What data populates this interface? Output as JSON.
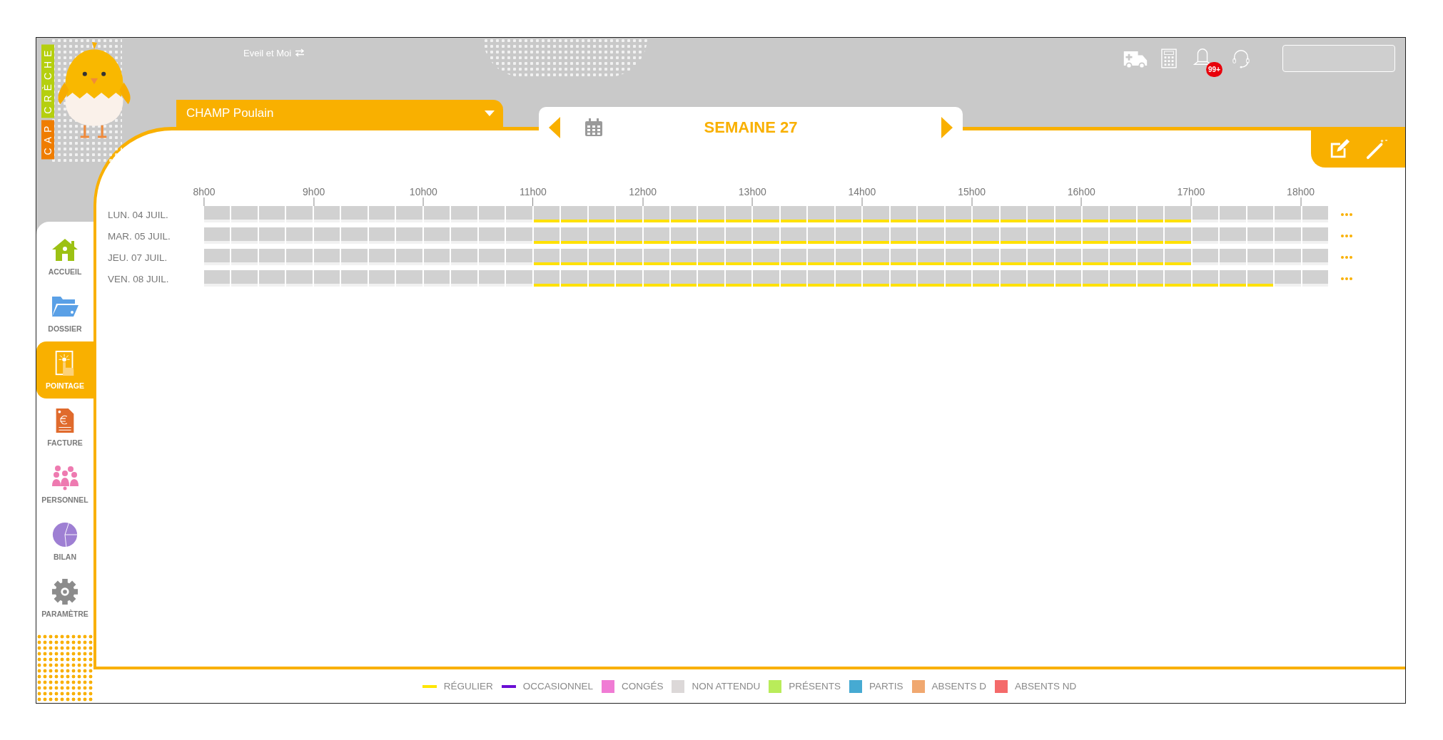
{
  "header": {
    "logo": {
      "first": "CAP",
      "second": "CRÈCHE"
    },
    "structure": "Eveil et Moi",
    "notification_count": "99+"
  },
  "child_selector": {
    "value": "CHAMP Poulain"
  },
  "week": {
    "label": "SEMAINE 27"
  },
  "sidebar": {
    "items": [
      {
        "kind": "home",
        "label": "ACCUEIL",
        "selected": false
      },
      {
        "kind": "folder",
        "label": "DOSSIER",
        "selected": false
      },
      {
        "kind": "pointage",
        "label": "POINTAGE",
        "selected": true
      },
      {
        "kind": "invoice",
        "label": "FACTURE",
        "selected": false
      },
      {
        "kind": "people",
        "label": "PERSONNEL",
        "selected": false
      },
      {
        "kind": "pie",
        "label": "BILAN",
        "selected": false
      },
      {
        "kind": "gear",
        "label": "PARAMÈTRE",
        "selected": false
      }
    ]
  },
  "timeline": {
    "hours": [
      "8h00",
      "9h00",
      "10h00",
      "11h00",
      "12h00",
      "13h00",
      "14h00",
      "15h00",
      "16h00",
      "17h00",
      "18h00"
    ],
    "days": [
      {
        "label": "LUN. 04 JUIL.",
        "slots": [
          {
            "regular": false
          },
          {
            "regular": false
          },
          {
            "regular": false
          },
          {
            "regular": false
          },
          {
            "regular": false
          },
          {
            "regular": false
          },
          {
            "regular": false
          },
          {
            "regular": false
          },
          {
            "regular": false
          },
          {
            "regular": false
          },
          {
            "regular": false
          },
          {
            "regular": false
          },
          {
            "regular": true
          },
          {
            "regular": true
          },
          {
            "regular": true
          },
          {
            "regular": true
          },
          {
            "regular": true
          },
          {
            "regular": true
          },
          {
            "regular": true
          },
          {
            "regular": true
          },
          {
            "regular": true
          },
          {
            "regular": true
          },
          {
            "regular": true
          },
          {
            "regular": true
          },
          {
            "regular": true
          },
          {
            "regular": true
          },
          {
            "regular": true
          },
          {
            "regular": true
          },
          {
            "regular": true
          },
          {
            "regular": true
          },
          {
            "regular": true
          },
          {
            "regular": true
          },
          {
            "regular": true
          },
          {
            "regular": true
          },
          {
            "regular": true
          },
          {
            "regular": true
          },
          {
            "regular": false
          },
          {
            "regular": false
          },
          {
            "regular": false
          },
          {
            "regular": false
          },
          {
            "regular": false
          }
        ]
      },
      {
        "label": "MAR. 05 JUIL.",
        "slots": [
          {
            "regular": false
          },
          {
            "regular": false
          },
          {
            "regular": false
          },
          {
            "regular": false
          },
          {
            "regular": false
          },
          {
            "regular": false
          },
          {
            "regular": false
          },
          {
            "regular": false
          },
          {
            "regular": false
          },
          {
            "regular": false
          },
          {
            "regular": false
          },
          {
            "regular": false
          },
          {
            "regular": true
          },
          {
            "regular": true
          },
          {
            "regular": true
          },
          {
            "regular": true
          },
          {
            "regular": true
          },
          {
            "regular": true
          },
          {
            "regular": true
          },
          {
            "regular": true
          },
          {
            "regular": true
          },
          {
            "regular": true
          },
          {
            "regular": true
          },
          {
            "regular": true
          },
          {
            "regular": true
          },
          {
            "regular": true
          },
          {
            "regular": true
          },
          {
            "regular": true
          },
          {
            "regular": true
          },
          {
            "regular": true
          },
          {
            "regular": true
          },
          {
            "regular": true
          },
          {
            "regular": true
          },
          {
            "regular": true
          },
          {
            "regular": true
          },
          {
            "regular": true
          },
          {
            "regular": false
          },
          {
            "regular": false
          },
          {
            "regular": false
          },
          {
            "regular": false
          },
          {
            "regular": false
          }
        ]
      },
      {
        "label": "JEU. 07 JUIL.",
        "slots": [
          {
            "regular": false
          },
          {
            "regular": false
          },
          {
            "regular": false
          },
          {
            "regular": false
          },
          {
            "regular": false
          },
          {
            "regular": false
          },
          {
            "regular": false
          },
          {
            "regular": false
          },
          {
            "regular": false
          },
          {
            "regular": false
          },
          {
            "regular": false
          },
          {
            "regular": false
          },
          {
            "regular": true
          },
          {
            "regular": true
          },
          {
            "regular": true
          },
          {
            "regular": true
          },
          {
            "regular": true
          },
          {
            "regular": true
          },
          {
            "regular": true
          },
          {
            "regular": true
          },
          {
            "regular": true
          },
          {
            "regular": true
          },
          {
            "regular": true
          },
          {
            "regular": true
          },
          {
            "regular": true
          },
          {
            "regular": true
          },
          {
            "regular": true
          },
          {
            "regular": true
          },
          {
            "regular": true
          },
          {
            "regular": true
          },
          {
            "regular": true
          },
          {
            "regular": true
          },
          {
            "regular": true
          },
          {
            "regular": true
          },
          {
            "regular": true
          },
          {
            "regular": true
          },
          {
            "regular": false
          },
          {
            "regular": false
          },
          {
            "regular": false
          },
          {
            "regular": false
          },
          {
            "regular": false
          }
        ]
      },
      {
        "label": "VEN. 08 JUIL.",
        "slots": [
          {
            "regular": false
          },
          {
            "regular": false
          },
          {
            "regular": false
          },
          {
            "regular": false
          },
          {
            "regular": false
          },
          {
            "regular": false
          },
          {
            "regular": false
          },
          {
            "regular": false
          },
          {
            "regular": false
          },
          {
            "regular": false
          },
          {
            "regular": false
          },
          {
            "regular": false
          },
          {
            "regular": true
          },
          {
            "regular": true
          },
          {
            "regular": true
          },
          {
            "regular": true
          },
          {
            "regular": true
          },
          {
            "regular": true
          },
          {
            "regular": true
          },
          {
            "regular": true
          },
          {
            "regular": true
          },
          {
            "regular": true
          },
          {
            "regular": true
          },
          {
            "regular": true
          },
          {
            "regular": true
          },
          {
            "regular": true
          },
          {
            "regular": true
          },
          {
            "regular": true
          },
          {
            "regular": true
          },
          {
            "regular": true
          },
          {
            "regular": true
          },
          {
            "regular": true
          },
          {
            "regular": true
          },
          {
            "regular": true
          },
          {
            "regular": true
          },
          {
            "regular": true
          },
          {
            "regular": true
          },
          {
            "regular": true
          },
          {
            "regular": true
          },
          {
            "regular": false
          },
          {
            "regular": false
          }
        ]
      }
    ]
  },
  "legend": [
    {
      "kind": "line",
      "label": "RÉGULIER",
      "color": "#ffe600"
    },
    {
      "kind": "line",
      "label": "OCCASIONNEL",
      "color": "#6a0dd4"
    },
    {
      "kind": "square",
      "label": "CONGÉS",
      "color": "#f07bd4"
    },
    {
      "kind": "square",
      "label": "NON ATTENDU",
      "color": "#dcd8d8"
    },
    {
      "kind": "square",
      "label": "PRÉSENTS",
      "color": "#b9ec5a"
    },
    {
      "kind": "square",
      "label": "PARTIS",
      "color": "#46aad2"
    },
    {
      "kind": "square",
      "label": "ABSENTS D",
      "color": "#f0a870"
    },
    {
      "kind": "square",
      "label": "ABSENTS ND",
      "color": "#f46a6a"
    }
  ]
}
